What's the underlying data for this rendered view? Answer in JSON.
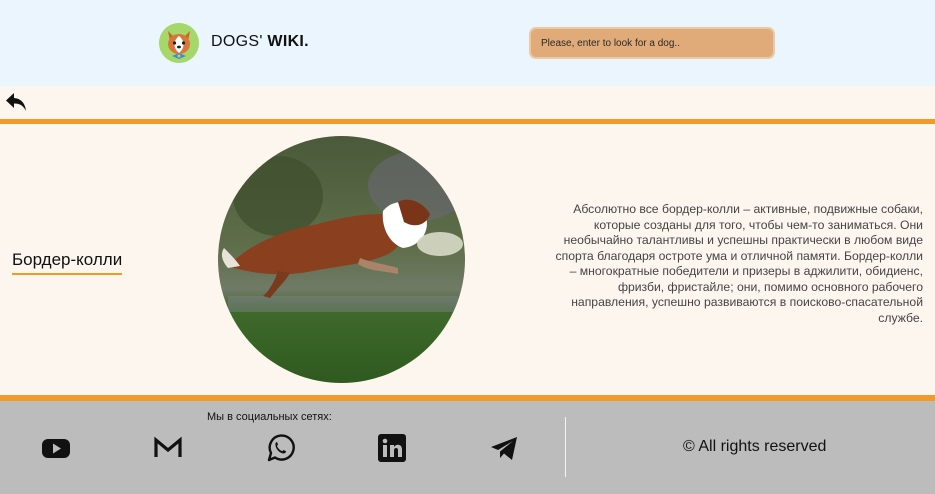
{
  "header": {
    "brand_light": "DOGS' ",
    "brand_bold": "WIKI.",
    "search_placeholder": "Please, enter to look for a dog.."
  },
  "breed": {
    "name": "Бордер-колли",
    "description": "Абсолютно все бордер-колли – активные, подвижные собаки, которые созданы для того, чтобы чем-то заниматься. Они необычайно талантливы и успешны практически в любом виде спорта благодаря остроте ума и отличной памяти. Бордер-колли – многократные победители и призеры в аджилити, обидиенс, фризби, фристайле; они, помимо основного рабочего направления, успешно развиваются в поисково-спасательной службе."
  },
  "footer": {
    "social_title": "Мы в социальных сетях:",
    "social": [
      "youtube-icon",
      "gmail-icon",
      "whatsapp-icon",
      "linkedin-icon",
      "telegram-icon"
    ],
    "rights": "© All rights reserved"
  },
  "colors": {
    "accent": "#f19a2a",
    "header_bg": "#eaf5fd",
    "search_bg": "#e0ab78",
    "footer_bg": "#bcbcbc",
    "page_bg": "#fdf6ee"
  }
}
